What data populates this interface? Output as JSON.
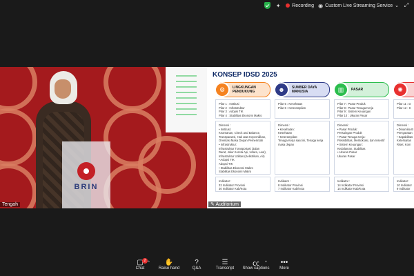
{
  "topbar": {
    "recording_label": "Recording",
    "stream_label": "Custom Live Streaming Service",
    "stream_caret": "⌄"
  },
  "video": {
    "speaker_name": "Tengah",
    "podium_logo_text": "BRIN",
    "slide_share_label": "Auditorium"
  },
  "slide": {
    "title": "KONSEP IDSD 2025",
    "pillars": [
      {
        "color": "#f58220",
        "icon": "gear-icon",
        "title": "LINGKUNGAN PENDUKUNG",
        "pillar_lines": "Pilar 1 : Institusi\nPilar 2 : Infrastruktur\nPilar 3 : Adopsi TIK\nPilar 4 : Stabilitas Ekonomi Makro",
        "dimensi_lines": "Dimensi :\n• Institusi:\n  Keamanan, Check and Balance, Transparansi, Hak atas Kepemilikan, Orientasi Masa Depan Pemerintah\n• Infrastruktur:\n  Infrastruktur Transportasi (Jalan Darat, Jalur Kereta Api, Udara, Laut), Infrastruktur Utilitas (Kelistrikan, Air)\n• Adopsi TIK\n  Adopsi TIK\n• Stabilitas Ekonomi Makro\n  Stabilitas Ekonomi Makro",
        "indikator_lines": "Indikator :\n32 Indikator Provinsi\n30 Indikator Kab/Kota"
      },
      {
        "color": "#2e3a87",
        "icon": "people-icon",
        "title": "SUMBER DAYA MANUSIA",
        "pillar_lines": "Pilar 5 : Kesehatan\nPilar 6 : Keterampilan",
        "dimensi_lines": "Dimensi :\n• Kesehatan:\n  Kesehatan\n• Keterampilan:\n  Tenaga Kerja saat ini, Tenaga kerja masa depan",
        "indikator_lines": "Indikator :\n8 Indikator Provinsi\n7 Indikator Kab/Kota"
      },
      {
        "color": "#2bbd4d",
        "icon": "chart-icon",
        "title": "PASAR",
        "pillar_lines": "Pilar 7 : Pasar Produk\nPilar 8 : Pasar Tenaga Kerja\nPilar 9 : Sistem Keuangan\nPilar 10 : Ukuran Pasar",
        "dimensi_lines": "Dimensi :\n• Pasar Produk:\n  Persaingan Produk\n• Pasar Tenaga Kerja:\n  Fleksibilitas, Meritokrasi, dan Insentif\n• Sistem Keuangan:\n  Kedalaman, Stabilitas\n• Ukuran Pasar\n  Ukuran Pasar",
        "indikator_lines": "Indikator :\n14 Indikator Provinsi\n14 Indikator Kab/Kota"
      },
      {
        "color": "#e8302f",
        "icon": "bulb-icon",
        "title": "",
        "pillar_lines": "Pilar 11 : D\nPilar 12 : K",
        "dimensi_lines": "Dimensi :\n• Dinamika B\n  Persyaratan\n• Kapabilitas\n  Keterkaitan\n  Riset, Kom",
        "indikator_lines": "Indikator :\n10 Indikator\n9 Indikator"
      }
    ]
  },
  "toolbar": {
    "chat": "Chat",
    "chat_badge": "2",
    "raise_hand": "Raise hand",
    "qa": "Q&A",
    "transcript": "Transcript",
    "show_captions": "Show captions",
    "more": "More"
  }
}
